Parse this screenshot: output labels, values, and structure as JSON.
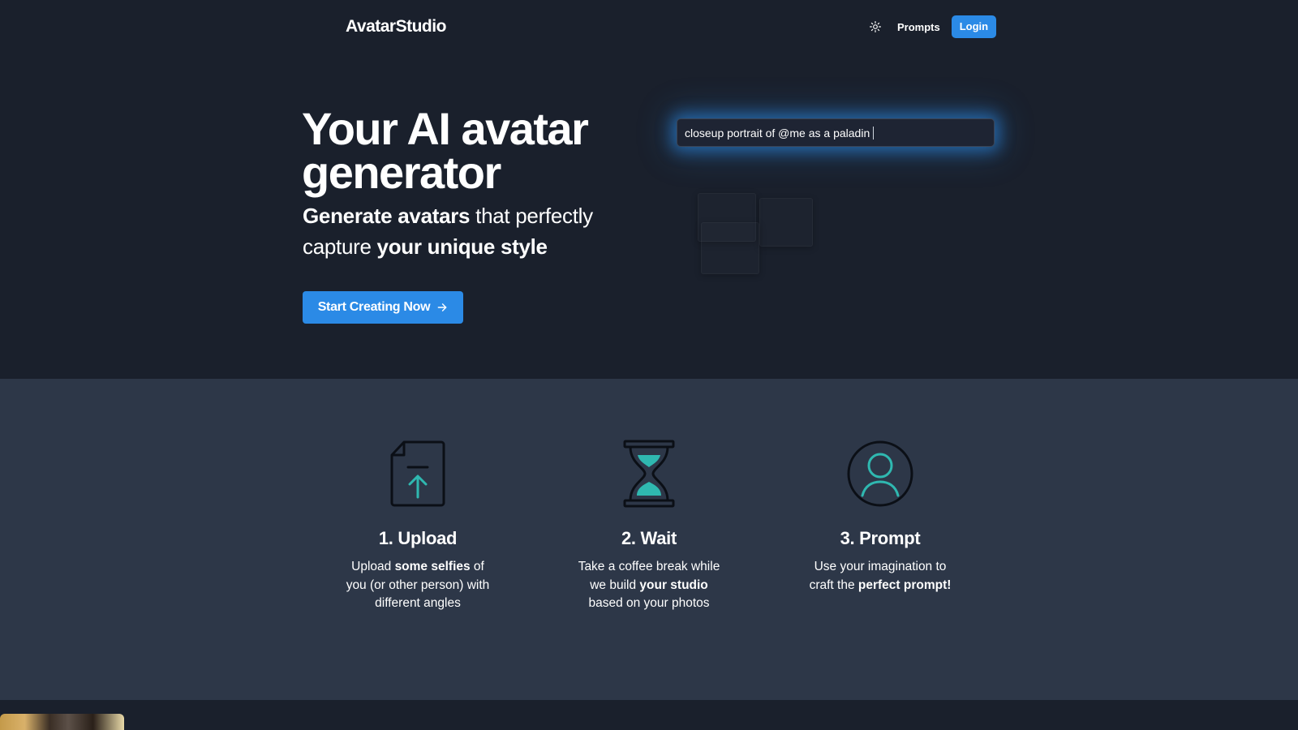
{
  "header": {
    "logo": "AvatarStudio",
    "theme_icon": "sun-icon",
    "prompts_label": "Prompts",
    "login_label": "Login"
  },
  "hero": {
    "title_line1": "Your AI avatar",
    "title_line2": "generator",
    "sub_part1": "Generate avatars",
    "sub_part2": " that perfectly capture ",
    "sub_part3": "your unique style",
    "cta_label": "Start Creating Now",
    "cta_icon": "arrow-right-icon",
    "prompt_value": "closeup portrait of @me as a paladin"
  },
  "steps": [
    {
      "icon": "file-upload-icon",
      "title": "1. Upload",
      "desc_a": "Upload ",
      "desc_b": "some selfies",
      "desc_c": " of you (or other person) with different angles"
    },
    {
      "icon": "hourglass-icon",
      "title": "2. Wait",
      "desc_a": "Take a coffee break while we build ",
      "desc_b": "your studio",
      "desc_c": " based on your photos"
    },
    {
      "icon": "user-circle-icon",
      "title": "3. Prompt",
      "desc_a": "Use your imagination to craft the ",
      "desc_b": "perfect prompt!",
      "desc_c": ""
    }
  ],
  "colors": {
    "accent": "#2b8ae6",
    "icon_teal": "#2fb8b0",
    "bg_dark": "#1a202c",
    "bg_section": "#2d3748"
  }
}
